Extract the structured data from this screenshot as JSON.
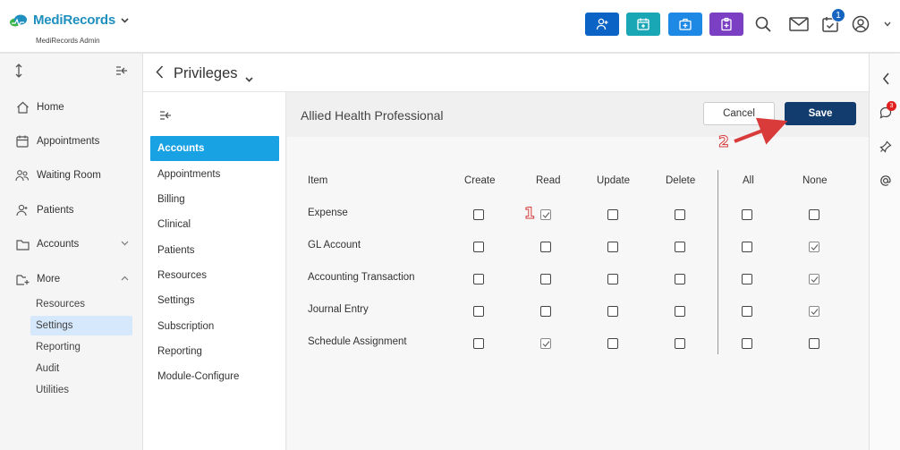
{
  "app": {
    "name": "MediRecords",
    "subtitle": "MediRecords Admin",
    "notification_count": "1"
  },
  "toolbar_colors": {
    "add_patient": "#0b63c6",
    "calendar": "#19a6b5",
    "medical_kit": "#1e88e5",
    "clipboard": "#7b3fc4"
  },
  "sidebar": {
    "items": [
      {
        "label": "Home",
        "icon": "home-icon"
      },
      {
        "label": "Appointments",
        "icon": "calendar-icon"
      },
      {
        "label": "Waiting Room",
        "icon": "people-icon"
      },
      {
        "label": "Patients",
        "icon": "person-icon"
      },
      {
        "label": "Accounts",
        "icon": "folder-icon"
      },
      {
        "label": "More",
        "icon": "folder-plus-icon"
      }
    ],
    "sub_items": [
      "Resources",
      "Settings",
      "Reporting",
      "Audit",
      "Utilities"
    ]
  },
  "page": {
    "title": "Privileges"
  },
  "submenu": {
    "items": [
      "Accounts",
      "Appointments",
      "Billing",
      "Clinical",
      "Patients",
      "Resources",
      "Settings",
      "Subscription",
      "Reporting",
      "Module-Configure"
    ]
  },
  "main": {
    "title": "Allied Health Professional",
    "cancel_label": "Cancel",
    "save_label": "Save"
  },
  "table": {
    "columns": [
      "Item",
      "Create",
      "Read",
      "Update",
      "Delete",
      "All",
      "None"
    ],
    "rows": [
      {
        "label": "Expense",
        "create": false,
        "read": true,
        "update": false,
        "delete": false,
        "all": false,
        "none": false
      },
      {
        "label": "GL Account",
        "create": false,
        "read": false,
        "update": false,
        "delete": false,
        "all": false,
        "none": true
      },
      {
        "label": "Accounting Transaction",
        "create": false,
        "read": false,
        "update": false,
        "delete": false,
        "all": false,
        "none": true
      },
      {
        "label": "Journal Entry",
        "create": false,
        "read": false,
        "update": false,
        "delete": false,
        "all": false,
        "none": true
      },
      {
        "label": "Schedule Assignment",
        "create": false,
        "read": true,
        "update": false,
        "delete": false,
        "all": false,
        "none": false
      }
    ]
  },
  "annotations": {
    "step1": "1",
    "step2": "2",
    "color": "#d93a3a"
  },
  "rail": {
    "badge": "3"
  }
}
